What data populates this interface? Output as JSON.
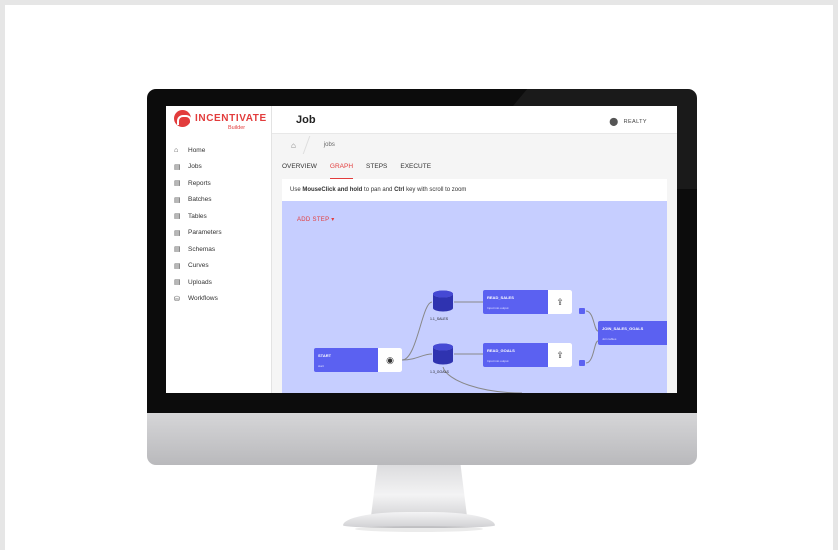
{
  "app": {
    "logo_text": "INCENTIVATE",
    "logo_sub": "Builder",
    "page_title": "Job",
    "org": "REALTY"
  },
  "sidebar": {
    "items": [
      {
        "label": "Home",
        "icon": "home-icon"
      },
      {
        "label": "Jobs",
        "icon": "archive-icon"
      },
      {
        "label": "Reports",
        "icon": "archive-icon"
      },
      {
        "label": "Batches",
        "icon": "archive-icon"
      },
      {
        "label": "Tables",
        "icon": "archive-icon"
      },
      {
        "label": "Parameters",
        "icon": "archive-icon"
      },
      {
        "label": "Schemas",
        "icon": "archive-icon"
      },
      {
        "label": "Curves",
        "icon": "archive-icon"
      },
      {
        "label": "Uploads",
        "icon": "archive-icon"
      },
      {
        "label": "Workflows",
        "icon": "workflow-icon"
      }
    ]
  },
  "breadcrumb": {
    "current": "jobs"
  },
  "tabs": [
    {
      "label": "OVERVIEW",
      "active": false
    },
    {
      "label": "GRAPH",
      "active": true
    },
    {
      "label": "STEPS",
      "active": false
    },
    {
      "label": "EXECUTE",
      "active": false
    }
  ],
  "hint": {
    "pre": "Use ",
    "mouse": "MouseClick and hold",
    "mid": " to pan and ",
    "ctrl": "Ctrl",
    "post": " key with scroll to zoom"
  },
  "graph": {
    "add_step": "ADD STEP",
    "nodes": {
      "start": {
        "title": "START",
        "sub": "start"
      },
      "read_sales": {
        "title": "READ_SALES",
        "sub": "Input into output"
      },
      "read_goals": {
        "title": "READ_GOALS",
        "sub": "Input into output"
      },
      "join": {
        "title": "JOIN_SALES_GOALS",
        "sub": "Join tables"
      }
    },
    "tables": {
      "sales": "1.1_SALES",
      "goals": "1.3_GOALS"
    }
  },
  "colors": {
    "accent": "#e23c3c",
    "node": "#5b61f1",
    "canvas": "#c6ceff"
  }
}
